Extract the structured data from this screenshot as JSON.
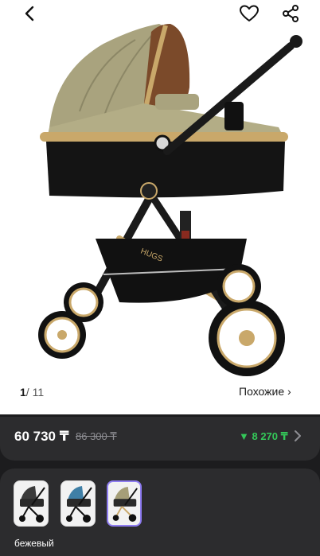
{
  "nav": {
    "back_icon": "chevron-left-icon",
    "favorite_icon": "heart-icon",
    "share_icon": "share-icon"
  },
  "gallery": {
    "current": "1",
    "total": "11",
    "separator": "/",
    "similar_label": "Похожие ›",
    "logo_text": "HUGS"
  },
  "price": {
    "current": "60 730 ₸",
    "old": "86 300 ₸",
    "discount": "▼ 8 270 ₸",
    "accent": "#34c759"
  },
  "variants": {
    "selected_label": "бежевый",
    "items": [
      {
        "color": "#3a3a3a"
      },
      {
        "color": "#3f7fa6"
      },
      {
        "color": "#a59e78"
      }
    ]
  },
  "colors": {
    "background_dark": "#1c1c1e",
    "card_dark": "#2c2c2e",
    "selected_border": "#8e7cf0"
  }
}
